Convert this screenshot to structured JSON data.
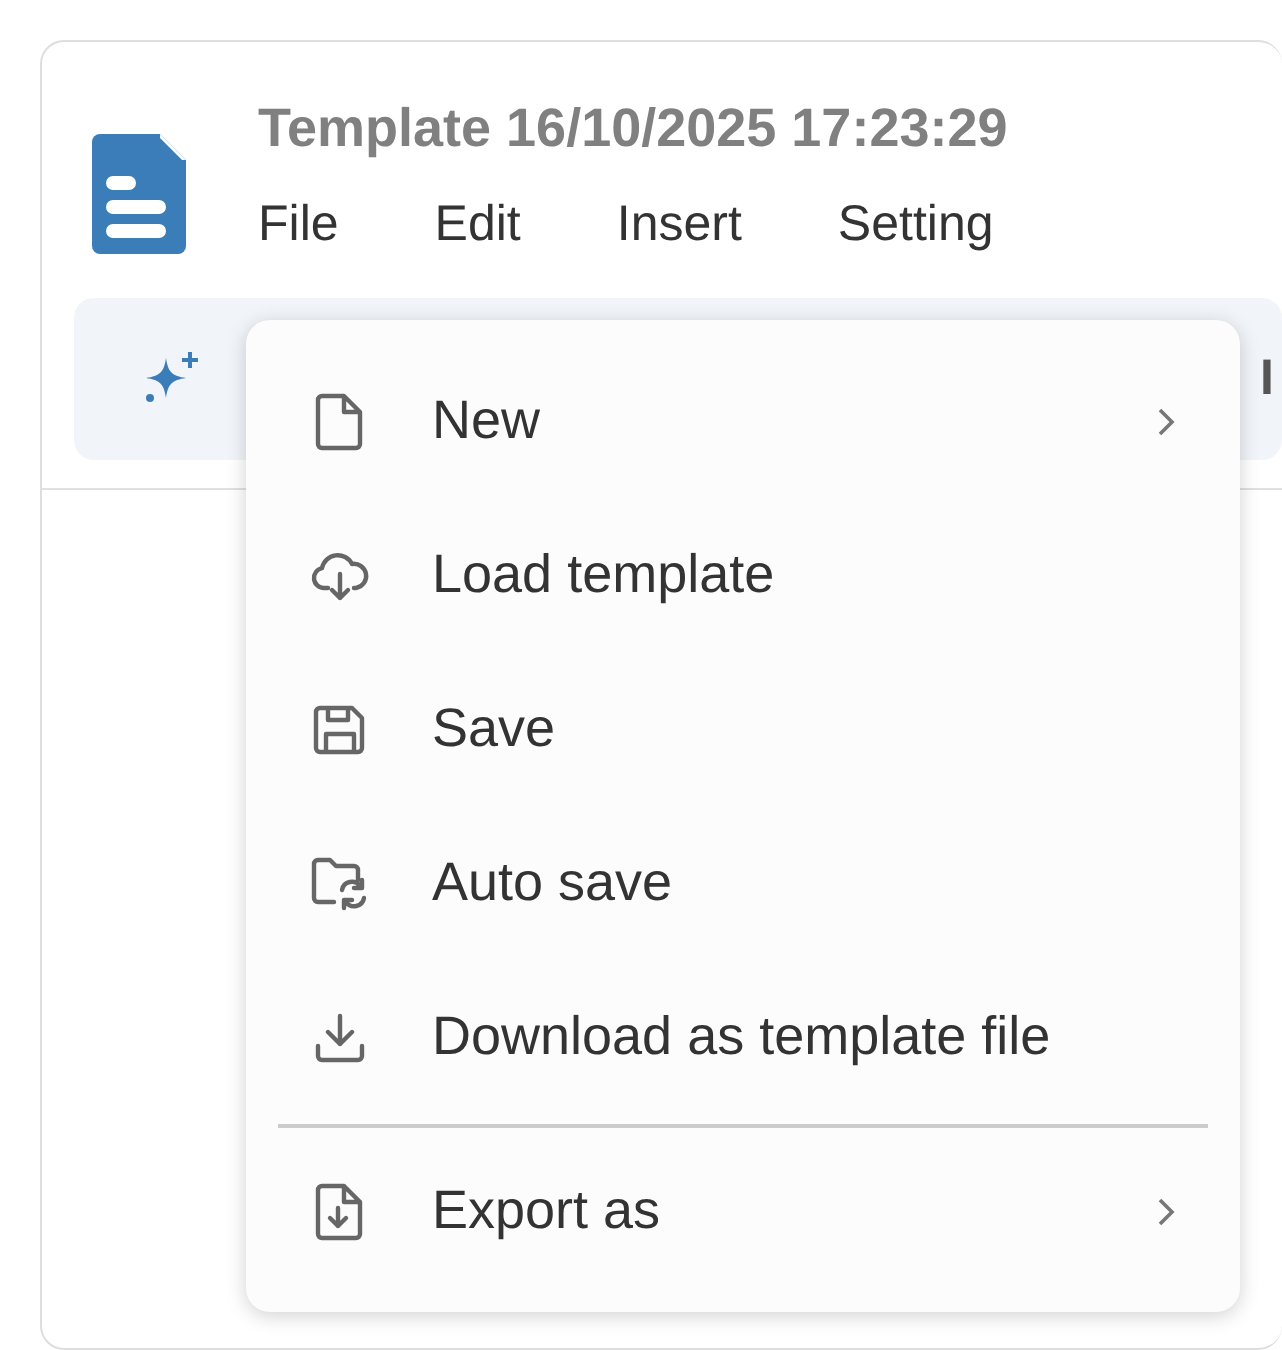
{
  "document": {
    "title": "Template 16/10/2025 17:23:29"
  },
  "menu_bar": [
    {
      "label": "File"
    },
    {
      "label": "Edit"
    },
    {
      "label": "Insert"
    },
    {
      "label": "Setting"
    }
  ],
  "toolbar": {
    "cut_label": "I"
  },
  "file_menu": [
    {
      "kind": "item",
      "label": "New",
      "has_submenu": true
    },
    {
      "kind": "item",
      "label": "Load template",
      "has_submenu": false
    },
    {
      "kind": "item",
      "label": "Save",
      "has_submenu": false
    },
    {
      "kind": "item",
      "label": "Auto save",
      "has_submenu": false
    },
    {
      "kind": "item",
      "label": "Download as template file",
      "has_submenu": false
    },
    {
      "kind": "separator"
    },
    {
      "kind": "item",
      "label": "Export as",
      "has_submenu": true
    }
  ]
}
